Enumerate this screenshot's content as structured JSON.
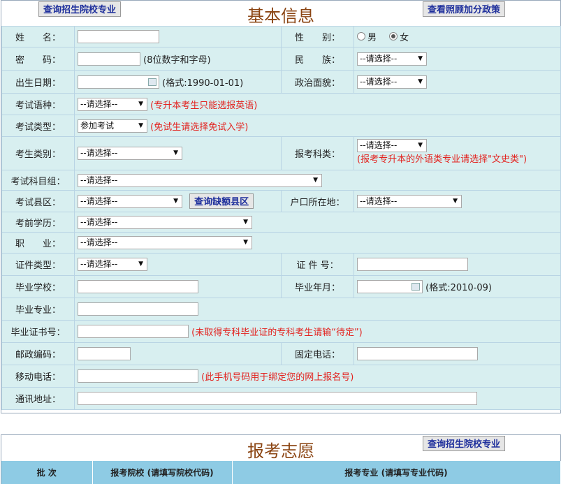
{
  "basic": {
    "title": "基本信息",
    "btn_query_school": "查询招生院校专业",
    "btn_bonus_policy": "查看照顾加分政策"
  },
  "form": {
    "name_label": "姓　　名：",
    "gender_label": "性　　别：",
    "gender_male": "男",
    "gender_female": "女",
    "password_label": "密　　码：",
    "password_hint": "(8位数字和字母)",
    "ethnicity_label": "民　　族：",
    "ethnicity_value": "--请选择--",
    "birth_label": "出生日期：",
    "birth_hint": "(格式:1990-01-01)",
    "political_label": "政治面貌：",
    "political_value": "--请选择--",
    "language_label": "考试语种：",
    "language_value": "--请选择--",
    "language_hint": "(专升本考生只能选报英语)",
    "examtype_label": "考试类型：",
    "examtype_value": "参加考试",
    "examtype_hint": "(免试生请选择免试入学)",
    "category_label": "考生类别：",
    "category_value": "--请选择--",
    "subjtype_label": "报考科类：",
    "subjtype_value": "--请选择--",
    "subjtype_hint": "(报考专升本的外语类专业请选择\"文史类\")",
    "subjgroup_label": "考试科目组：",
    "subjgroup_value": "--请选择--",
    "county_label": "考试县区：",
    "county_value": "--请选择--",
    "btn_query_county": "查询缺额县区",
    "hukou_label": "户口所在地：",
    "hukou_value": "--请选择--",
    "education_label": "考前学历：",
    "education_value": "--请选择--",
    "occupation_label": "职　　业：",
    "occupation_value": "--请选择--",
    "idtype_label": "证件类型：",
    "idtype_value": "--请选择--",
    "idno_label": "证 件 号：",
    "school_label": "毕业学校：",
    "gradmonth_label": "毕业年月：",
    "gradmonth_hint": "(格式:2010-09)",
    "major_label": "毕业专业：",
    "cert_label": "毕业证书号：",
    "cert_hint": "(未取得专科毕业证的专科考生请输“待定”)",
    "postcode_label": "邮政编码：",
    "phone_label": "固定电话：",
    "mobile_label": "移动电话：",
    "mobile_hint": "(此手机号码用于绑定您的网上报名号)",
    "address_label": "通讯地址："
  },
  "volunteer": {
    "title": "报考志愿",
    "btn_query_school": "查询招生院校专业",
    "col_batch": "批 次",
    "col_school": "报考院校 (请填写院校代码)",
    "col_major": "报考专业 (请填写专业代码)"
  },
  "colors": {
    "title": "#8b4513",
    "hint": "#e3221e",
    "row_bg": "#d8eff0",
    "header_bg": "#8ecbe4",
    "button_text": "#1e2f9c"
  }
}
